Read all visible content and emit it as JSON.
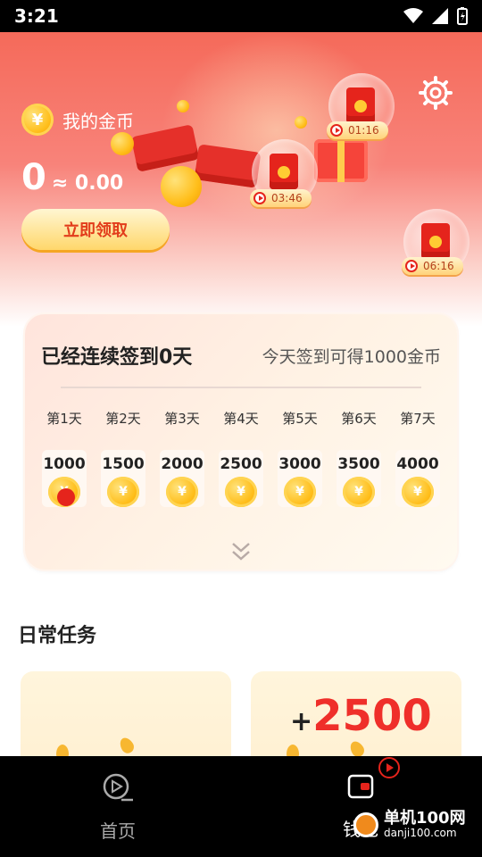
{
  "status_bar": {
    "time": "3:21"
  },
  "header": {
    "coin_label": "我的金币",
    "coin_symbol": "¥",
    "balance_coins": "0",
    "balance_money": "≈ 0.00",
    "claim_button": "立即领取",
    "settings_icon": "gear-icon",
    "timers": [
      "01:16",
      "03:46",
      "06:16"
    ]
  },
  "checkin": {
    "title": "已经连续签到0天",
    "hint": "今天签到可得1000金币",
    "days": [
      {
        "label": "第1天",
        "amount": "1000"
      },
      {
        "label": "第2天",
        "amount": "1500"
      },
      {
        "label": "第3天",
        "amount": "2000"
      },
      {
        "label": "第4天",
        "amount": "2500"
      },
      {
        "label": "第5天",
        "amount": "3000"
      },
      {
        "label": "第6天",
        "amount": "3500"
      },
      {
        "label": "第7天",
        "amount": "4000"
      }
    ],
    "expand_icon": "chevron-double-down-icon"
  },
  "daily_tasks": {
    "title": "日常任务",
    "cards": [
      {
        "reward": ""
      },
      {
        "plus": "+",
        "reward": "2500"
      }
    ]
  },
  "tabbar": {
    "tabs": [
      {
        "label": "首页",
        "icon": "video-play-icon"
      },
      {
        "label": "钱包",
        "icon": "wallet-icon"
      }
    ]
  },
  "watermark": {
    "text": "单机100网",
    "domain": "danji100.com"
  },
  "colors": {
    "accent_red": "#e5241c",
    "gold": "#ffbe1a",
    "hero_top": "#f56a5a"
  }
}
